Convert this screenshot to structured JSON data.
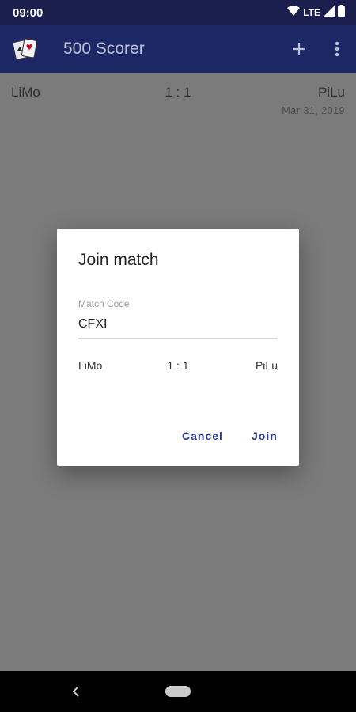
{
  "status_bar": {
    "time": "09:00",
    "network": "LTE"
  },
  "app_bar": {
    "title": "500 Scorer",
    "logo_icon": "playing-cards-icon",
    "add_icon": "plus-icon",
    "menu_icon": "more-vert-icon",
    "color": "#1f2866"
  },
  "matches": [
    {
      "left": "LiMo",
      "score": "1 : 1",
      "right": "PiLu",
      "date": "Mar 31, 2019"
    }
  ],
  "dialog": {
    "title": "Join match",
    "field_label": "Match Code",
    "field_value": "CFXI",
    "preview": {
      "left": "LiMo",
      "score": "1 : 1",
      "right": "PiLu"
    },
    "cancel_label": "Cancel",
    "join_label": "Join",
    "accent": "#2a3a9a"
  },
  "nav_bar": {
    "back_icon": "back-chevron-icon",
    "home_icon": "home-pill-icon"
  }
}
